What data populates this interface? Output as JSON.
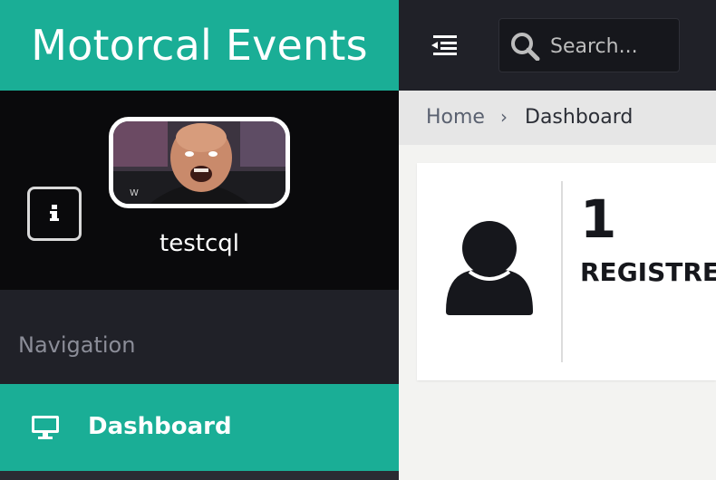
{
  "brand": {
    "title": "Motorcal Events"
  },
  "profile": {
    "username": "testcql"
  },
  "nav": {
    "heading": "Navigation",
    "items": [
      {
        "label": "Dashboard",
        "icon": "monitor-icon",
        "active": true
      }
    ]
  },
  "topbar": {
    "search": {
      "placeholder": "Search..."
    }
  },
  "breadcrumb": {
    "home": "Home",
    "separator": "›",
    "current": "Dashboard"
  },
  "stats": [
    {
      "value": "1",
      "label": "REGISTRED",
      "icon": "user-icon"
    }
  ],
  "colors": {
    "accent": "#1aae96",
    "dark": "#202128",
    "black": "#0a0a0c"
  }
}
